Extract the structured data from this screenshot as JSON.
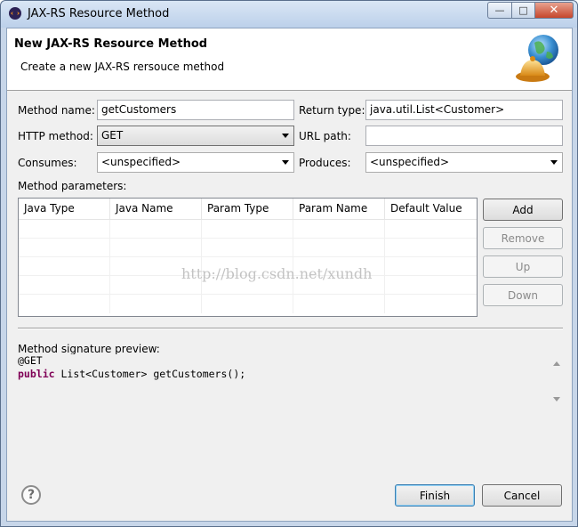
{
  "window": {
    "title": "JAX-RS Resource Method",
    "minimize_glyph": "—",
    "maximize_glyph": "□",
    "close_glyph": "✕"
  },
  "header": {
    "title": "New JAX-RS Resource Method",
    "description": "Create a new JAX-RS rersouce method",
    "icon": "globe-bell-icon"
  },
  "form": {
    "method_name_label": "Method name:",
    "method_name_value": "getCustomers",
    "return_type_label": "Return type:",
    "return_type_value": "java.util.List<Customer>",
    "http_method_label": "HTTP method:",
    "http_method_value": "GET",
    "url_path_label": "URL path:",
    "url_path_value": "",
    "consumes_label": "Consumes:",
    "consumes_value": "<unspecified>",
    "produces_label": "Produces:",
    "produces_value": "<unspecified>"
  },
  "parameters": {
    "label": "Method parameters:",
    "columns": [
      "Java Type",
      "Java Name",
      "Param Type",
      "Param Name",
      "Default Value"
    ],
    "buttons": {
      "add": "Add",
      "remove": "Remove",
      "up": "Up",
      "down": "Down"
    }
  },
  "preview": {
    "label": "Method signature preview:",
    "line1": "@GET",
    "line2_keyword": "public",
    "line2_rest": " List<Customer> getCustomers();"
  },
  "watermark": "http://blog.csdn.net/xundh",
  "footer": {
    "help_glyph": "?",
    "finish": "Finish",
    "cancel": "Cancel"
  },
  "colors": {
    "keyword": "#7f0055",
    "titlebar": "#c7d6e9",
    "close": "#c6462b"
  }
}
